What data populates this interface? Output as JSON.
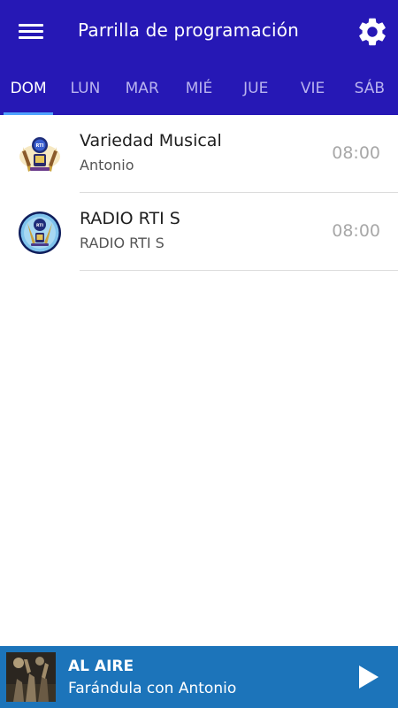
{
  "header": {
    "title": "Parrilla de programación",
    "menu_icon": "hamburger-menu-icon",
    "settings_icon": "gear-icon",
    "color": "#2618b5"
  },
  "tabs": [
    {
      "label": "DOM",
      "active": true
    },
    {
      "label": "LUN"
    },
    {
      "label": "MAR"
    },
    {
      "label": "MIÉ"
    },
    {
      "label": "JUE"
    },
    {
      "label": "VIE"
    },
    {
      "label": "SÁB"
    }
  ],
  "schedule": [
    {
      "title": "Variedad Musical",
      "host": "Antonio",
      "time": "08:00",
      "icon": "radio-rti-logo-instruments"
    },
    {
      "title": "RADIO RTI S",
      "host": "RADIO RTI S",
      "time": "08:00",
      "icon": "radio-rti-logo-round"
    }
  ],
  "player": {
    "label": "AL AIRE",
    "now_playing": "Farándula con Antonio",
    "color": "#1c74ba",
    "play_icon": "play-icon"
  }
}
